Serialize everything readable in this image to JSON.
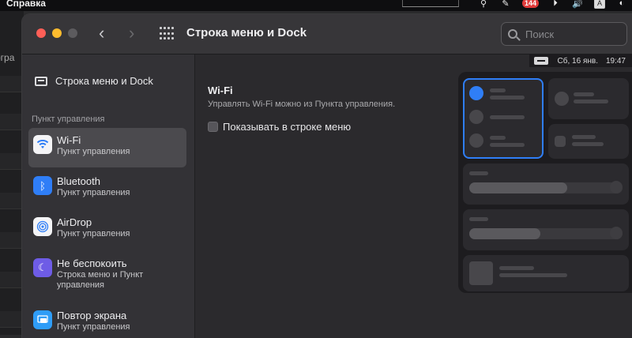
{
  "menubar": {
    "help_menu": "Справка",
    "mail_badge": "144",
    "input_source": "A"
  },
  "behind": {
    "text": "огра"
  },
  "window": {
    "title": "Строка меню и Dock"
  },
  "search": {
    "placeholder": "Поиск"
  },
  "sidebar": {
    "top_item": "Строка меню и Dock",
    "section_header": "Пункт управления",
    "items": [
      {
        "name": "Wi-Fi",
        "sub": "Пункт управления",
        "icon": "wifi-icon",
        "color": "#2f7ef7",
        "active": true
      },
      {
        "name": "Bluetooth",
        "sub": "Пункт управления",
        "icon": "bluetooth-icon",
        "color": "#2f7ef7",
        "active": false
      },
      {
        "name": "AirDrop",
        "sub": "Пункт управления",
        "icon": "airdrop-icon",
        "color": "#2f7ef7",
        "active": false
      },
      {
        "name": "Не беспокоить",
        "sub": "Строка меню и Пункт управления",
        "icon": "moon-icon",
        "color": "#6e5ce6",
        "active": false
      },
      {
        "name": "Повтор экрана",
        "sub": "Пункт управления",
        "icon": "screen-mirroring-icon",
        "color": "#2f9df7",
        "active": false
      }
    ]
  },
  "preview_menubar": {
    "date": "Сб, 16 янв.",
    "time": "19:47"
  },
  "main": {
    "heading": "Wi-Fi",
    "description": "Управлять Wi-Fi можно из Пункта управления.",
    "checkbox_label": "Показывать в строке меню",
    "checkbox_checked": false
  },
  "colors": {
    "accent": "#2f7ef7",
    "traffic_red": "#ff5f57",
    "traffic_yellow": "#febc2e"
  }
}
